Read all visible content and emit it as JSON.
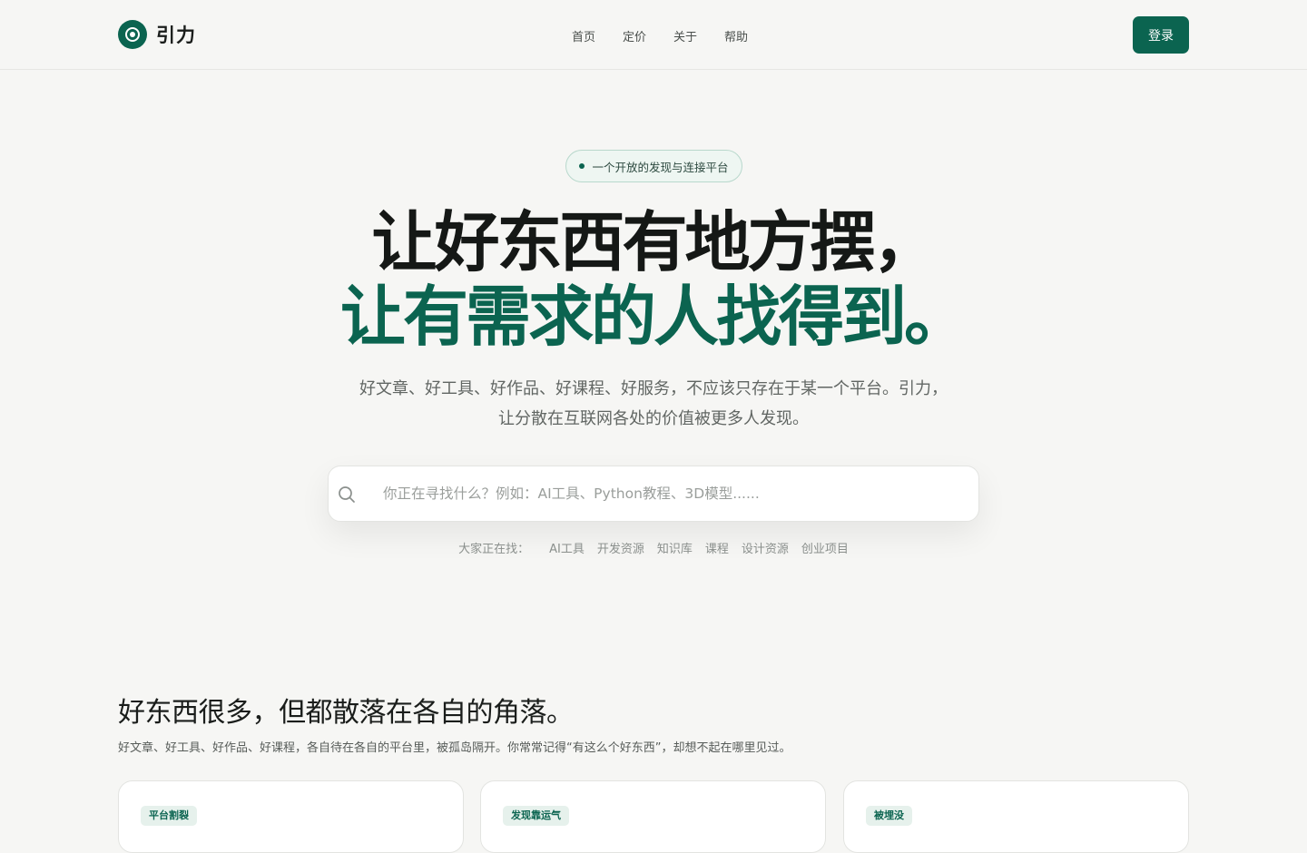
{
  "brand": {
    "name": "引力"
  },
  "nav": [
    {
      "label": "首页"
    },
    {
      "label": "定价"
    },
    {
      "label": "关于"
    },
    {
      "label": "帮助"
    }
  ],
  "header": {
    "login_label": "登录"
  },
  "hero": {
    "badge": "一个开放的发现与连接平台",
    "headline_line1": "让好东西有地方摆，",
    "headline_line2": "让有需求的人找得到。",
    "subtitle_line1": "好文章、好工具、好作品、好课程、好服务，不应该只存在于某一个平台。引力，",
    "subtitle_line2": "让分散在互联网各处的价值被更多人发现。"
  },
  "search": {
    "placeholder": "你正在寻找什么？例如：AI工具、Python教程、3D模型......",
    "trending_label": "大家正在找：",
    "trending": [
      "AI工具",
      "开发资源",
      "知识库",
      "课程",
      "设计资源",
      "创业项目"
    ]
  },
  "section": {
    "title": "好东西很多，但都散落在各自的角落。",
    "description": "好文章、好工具、好作品、好课程，各自待在各自的平台里，被孤岛隔开。你常常记得“有这么个好东西”，却想不起在哪里见过。",
    "cards": [
      {
        "tag": "平台割裂"
      },
      {
        "tag": "发现靠运气"
      },
      {
        "tag": "被埋没"
      }
    ]
  },
  "colors": {
    "accent": "#0b6450",
    "background": "#f6f6f4",
    "text": "#1a1d1b"
  }
}
